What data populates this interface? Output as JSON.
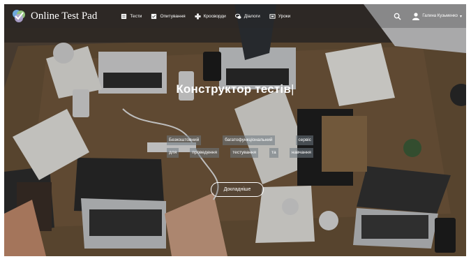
{
  "nav": {
    "logo_text": "Online Test Pad",
    "items": [
      {
        "label": "Тести",
        "icon": "test-icon"
      },
      {
        "label": "Опитування",
        "icon": "survey-icon"
      },
      {
        "label": "Кросворди",
        "icon": "crossword-icon"
      },
      {
        "label": "Діалоги",
        "icon": "dialog-icon"
      },
      {
        "label": "Уроки",
        "icon": "lessons-icon"
      }
    ],
    "user_name": "Галина Кузьменко"
  },
  "hero": {
    "title": "Конструктор тестів",
    "subtitle_lines": [
      [
        "Безкоштовний",
        "багатофункціональний",
        "сервіс"
      ],
      [
        "для",
        "проведення",
        "тестування",
        "та",
        "навчання"
      ]
    ],
    "button_label": "Докладніше"
  },
  "colors": {
    "overlay_text": "#ffffff",
    "highlight_bg": "#6e7882",
    "table_wood": "#6b5339"
  }
}
